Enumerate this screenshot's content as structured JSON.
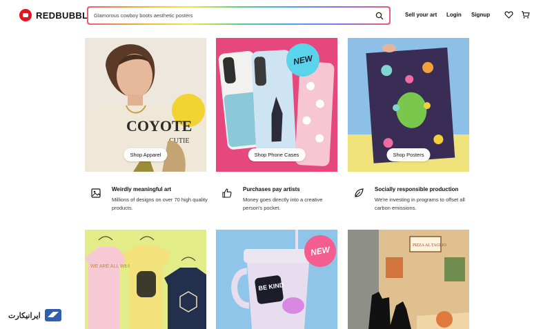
{
  "header": {
    "brand": "REDBUBBLE",
    "search_value": "Glamorous cowboy boots aesthetic posters",
    "nav": {
      "sell": "Sell your art",
      "login": "Login",
      "signup": "Signup"
    }
  },
  "tiles": [
    {
      "label": "Shop Apparel",
      "shirt_text": "COYOTE",
      "shirt_sub": "CUTIE"
    },
    {
      "label": "Shop Phone Cases",
      "badge": "NEW"
    },
    {
      "label": "Shop Posters"
    }
  ],
  "bottom_tiles": [
    {
      "shirt_text": "WE ARE ALL WEIRD"
    },
    {
      "badge": "NEW",
      "cup_text": "BE KIND"
    },
    {
      "sign_text": "PIZZA AL TAGLIO"
    }
  ],
  "features": [
    {
      "icon": "image-icon",
      "title": "Weirdly meaningful art",
      "text": "Millions of designs on over 70 high quality products."
    },
    {
      "icon": "thumbs-up-icon",
      "title": "Purchases pay artists",
      "text": "Money goes directly into a creative person's pocket."
    },
    {
      "icon": "leaf-icon",
      "title": "Socially responsible production",
      "text": "We're investing in programs to offset all carbon emissions."
    }
  ],
  "watermark": {
    "text": "ایرانیکارت"
  },
  "colors": {
    "brand_red": "#e41321",
    "phone_bg": "#e8457e",
    "poster_bg": "#8cc0e8",
    "tile_bg_apparel": "#f2ece4"
  }
}
